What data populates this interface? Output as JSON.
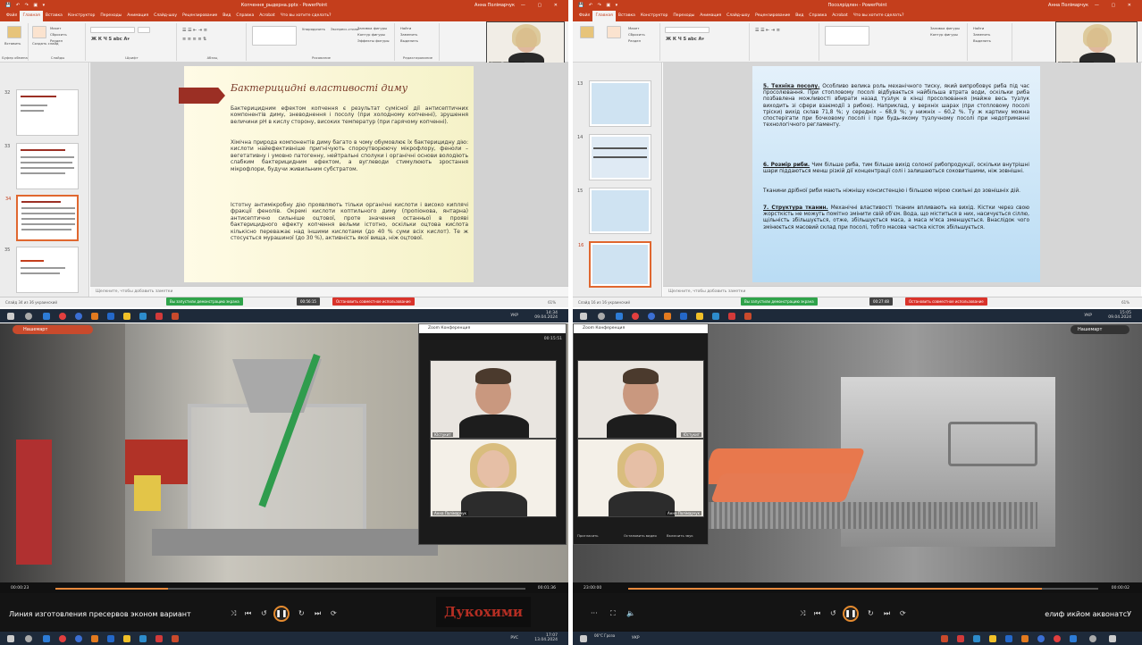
{
  "tl": {
    "title": "Копчення_рыдерна.pptx - PowerPoint",
    "user": "Анна Полімарчук",
    "menu": [
      "Файл",
      "Главная",
      "Вставка",
      "Конструктор",
      "Переходы",
      "Анимация",
      "Слайд-шоу",
      "Рецензирование",
      "Вид",
      "Справка",
      "Acrobat",
      "Что вы хотите сделать?"
    ],
    "menu_active": 1,
    "ribbon_groups": [
      "Буфер обмена",
      "Слайды",
      "Шрифт",
      "Абзац",
      "Рисование",
      "Редактирование"
    ],
    "ribbon_items": [
      "Макет",
      "Сбросить",
      "Раздел",
      "Найти",
      "Заменить",
      "Выделить",
      "Упорядочить",
      "Экспресс-стили",
      "Заливка фигуры",
      "Контур фигуры",
      "Эффекты фигуры",
      "Вставить",
      "Создать слайд"
    ],
    "slide_numbers": [
      "32",
      "33",
      "34",
      "35"
    ],
    "slide_title": "Бактерицидні властивості диму",
    "slide_p1": "Бактерицидним ефектом копчення є результат сумісної дії антисептичних компонентів диму, зневоднення і посолу (при холодному копченні), зрушення величини pH в кислу сторону, високих температур (при гарячому копченні).",
    "slide_p2": "Хімічна природа компонентів диму багато в чому обумовлює їх бактерицидну дію: кислоти найефективніше пригнічують спороутворюючу мікрофлору, феноли – вегетативну і умовно патогенну, нейтральні сполуки і органічні основи володіють слабким бактерицидним ефектом, а вуглеводи стимулюють зростання мікрофлори, будучи живильним субстратом.",
    "slide_p3": "Істотну антимікробну дію проявляють тільки органічні кислоти і високо киплячі фракції фенолів. Окремі кислоти коптильного диму (пропіонова, янтарна) антисептично сильніше оцтової, проте значення останньої в прояві бактерицидного ефекту копчення вельми істотно, оскільки оцтова кислота кількісно переважає над іншими кислотами (до 40 % суми всіх кислот). Те ж стосується мурашиної (до 30 %), активність якої вища, ніж оцтової.",
    "notes": "Щелкните, чтобы добавить заметки",
    "status_left": "Слайд 34 из 36   украинский",
    "banner_green": "Вы запустили демонстрацию экрана",
    "timer": "00:56:15",
    "banner_red": "Остановить совместное использование",
    "zoom": "61%",
    "cam1_name": "Анна Полімарчук",
    "cam2_name": "Юстукит",
    "clock_time": "14:34",
    "clock_date": "09.04.2024",
    "lang": "УКР"
  },
  "tr": {
    "title": "Посолрідлен - PowerPoint",
    "user": "Анна Полімарчук",
    "menu": [
      "Файл",
      "Главная",
      "Вставка",
      "Конструктор",
      "Переходы",
      "Анимация",
      "Слайд-шоу",
      "Рецензирование",
      "Вид",
      "Справка",
      "Acrobat",
      "Что вы хотите сделать?"
    ],
    "slide_numbers": [
      "13",
      "14",
      "15",
      "16"
    ],
    "s5_head": "5. Техніка посолу.",
    "s5_body": " Особливо велика роль механічного тиску, який випробовує риба під час просолювання. При стопловому посолі відбувається найбільша втрата води, оскільки риба позбавлена можливості вбирати назад тузлук в кінці просолювання (майже весь тузлук виходить зі сфери взаємодії з рибою). Наприклад, у верхніх шарах (при стопловому посолі тріски) вихід склав 71,8 %; у середніх – 68,9 %; у нижніх – 60,2 %. Ту ж картину можна спостерігати при бочковому посолі і при будь-якому тузлучному посолі при недотриманні технологічного регламенту.",
    "s6_head": "6. Розмір риби.",
    "s6_body": " Чим більше риба, тим більше вихід солоної рибопродукції, оскільки внутрішні шари піддаються менш різкій дії концентрації солі і залишаються соковитішими, ніж зовнішні.",
    "s6_extra": "Тканини дрібної риби мають ніжнішу консистенцію і більшою мірою схильні до зовнішніх дій.",
    "s7_head": "7. Структура тканин.",
    "s7_body": " Механічні властивості тканин впливають на вихід. Кістки через свою жорсткість не можуть помітно змінити свій об'єм. Вода, що міститься в них, насичується сіллю, щільність збільшується, отже, збільшується маса, а маса м'яса зменшується. Внаслідок чого змінюється масовий склад при посолі, тобто масова частка кісток збільшується.",
    "notes": "Щелкните, чтобы добавить заметки",
    "status_left": "Слайд 16 из 16   украинский",
    "banner_green": "Вы запустили демонстрацию экрана",
    "timer": "00:27:48",
    "banner_red": "Остановить совместное использование",
    "zoom": "61%",
    "cam1_name": "Анна Полімарчук",
    "cam2_name": "Юстукит",
    "clock_time": "15:05",
    "clock_date": "09.04.2024",
    "lang": "УКР"
  },
  "bl": {
    "channel": "Нашемарт",
    "zoom_title": "Zoom Конференция",
    "timer": "00:15:51",
    "cam1_name": "Юстукит",
    "cam2_name": "Анна Полімарчук",
    "time_elapsed": "00:00:23",
    "time_total": "00:01:36",
    "progress": 0.24,
    "video_title": "Линия изготовления пресервов эконом вариант",
    "watermark": "Дукохими",
    "clock_time": "17:07",
    "clock_date": "13.04.2024",
    "lang": "РУС"
  },
  "br": {
    "channel": "Нашемарт",
    "zoom_title": "Zoom Конференция",
    "cam1_name": "Юстукит",
    "cam2_name": "Анна Полімарчук",
    "time_elapsed": "23:00:00",
    "time_total": "00:00:02",
    "progress": 0.88,
    "video_title": "Установка мойки филе",
    "ctrl_labels": [
      "Включить звук",
      "Остановить видео",
      "Пригласить"
    ],
    "clock_time": "15:01",
    "clock_date": "09.04.2024",
    "weather": "06°C Гроза",
    "lang": "УКР"
  }
}
